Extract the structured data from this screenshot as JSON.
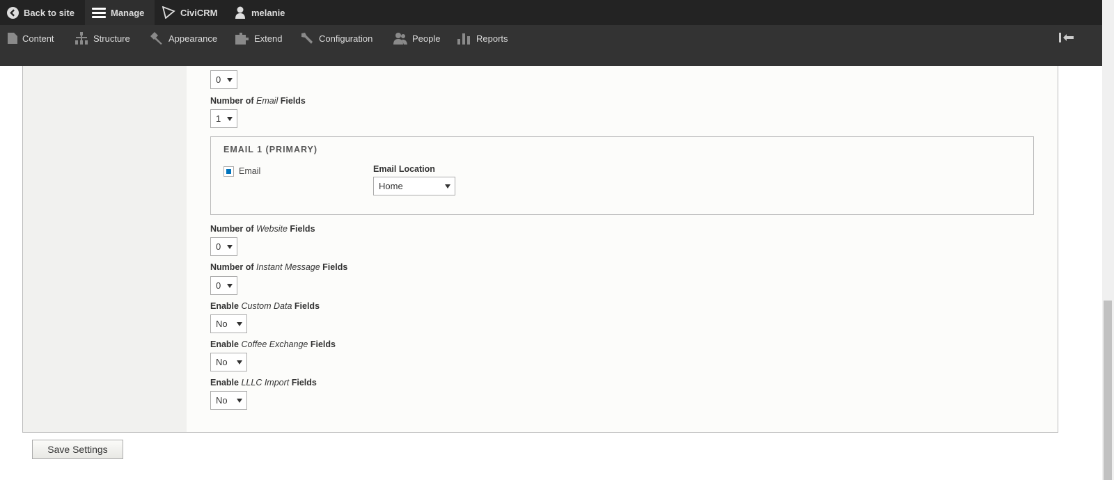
{
  "toolbar": {
    "back_to_site": "Back to site",
    "manage": "Manage",
    "civicrm": "CiviCRM",
    "user": "melanie"
  },
  "admin_menu": [
    {
      "label": "Content",
      "icon": "file-icon"
    },
    {
      "label": "Structure",
      "icon": "sitemap-icon"
    },
    {
      "label": "Appearance",
      "icon": "brush-icon"
    },
    {
      "label": "Extend",
      "icon": "puzzle-icon"
    },
    {
      "label": "Configuration",
      "icon": "wrench-icon"
    },
    {
      "label": "People",
      "icon": "people-icon"
    },
    {
      "label": "Reports",
      "icon": "bar-chart-icon"
    }
  ],
  "form": {
    "top_select": {
      "value": "0"
    },
    "email_count": {
      "label_pre": "Number of ",
      "label_em": "Email",
      "label_post": " Fields",
      "value": "1"
    },
    "email_fieldset": {
      "legend": "EMAIL 1 (PRIMARY)",
      "checkbox_label": "Email",
      "checked": true,
      "location_label": "Email Location",
      "location_value": "Home"
    },
    "website_count": {
      "label_pre": "Number of ",
      "label_em": "Website",
      "label_post": " Fields",
      "value": "0"
    },
    "im_count": {
      "label_pre": "Number of ",
      "label_em": "Instant Message",
      "label_post": " Fields",
      "value": "0"
    },
    "custom_data": {
      "label_pre": "Enable ",
      "label_em": "Custom Data",
      "label_post": " Fields",
      "value": "No"
    },
    "coffee_exchange": {
      "label_pre": "Enable ",
      "label_em": "Coffee Exchange",
      "label_post": " Fields",
      "value": "No"
    },
    "lllc_import": {
      "label_pre": "Enable ",
      "label_em": "LLLC Import",
      "label_post": " Fields",
      "value": "No"
    }
  },
  "save_label": "Save Settings",
  "colors": {
    "toolbar": "#232323",
    "menu": "#333333",
    "checkbox": "#0074bd"
  }
}
